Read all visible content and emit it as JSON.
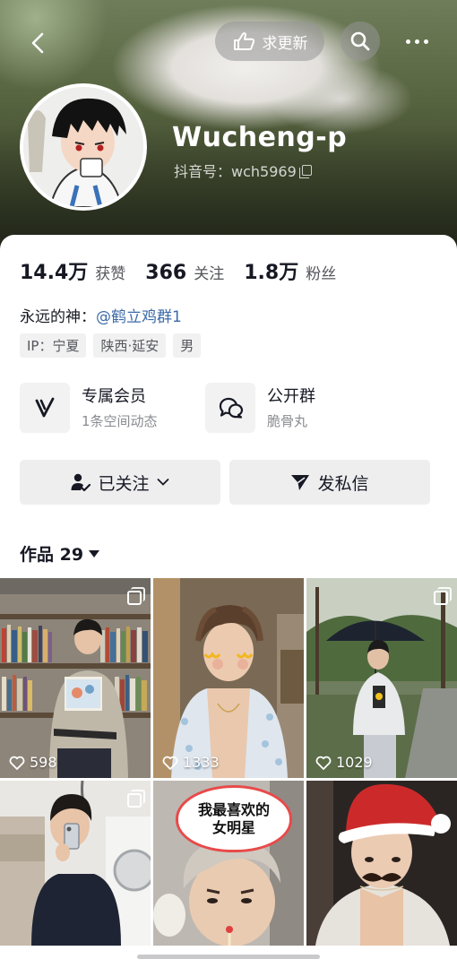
{
  "header": {
    "request_update_label": "求更新"
  },
  "profile": {
    "nickname": "Wucheng-p",
    "douyin_id": "抖音号：wch5969"
  },
  "stats": [
    {
      "value": "14.4万",
      "label": "获赞"
    },
    {
      "value": "366",
      "label": "关注"
    },
    {
      "value": "1.8万",
      "label": "粉丝"
    }
  ],
  "bio": {
    "prefix": "永远的神：",
    "mention": "@鹤立鸡群1"
  },
  "tags": [
    "IP：宁夏",
    "陕西·延安",
    "男"
  ],
  "features": [
    {
      "title": "专属会员",
      "subtitle": "1条空间动态"
    },
    {
      "title": "公开群",
      "subtitle": "脆骨丸"
    }
  ],
  "actions": {
    "followed_label": "已关注",
    "message_label": "发私信"
  },
  "works": {
    "label": "作品 29"
  },
  "videos": [
    {
      "likes": "598",
      "multi": true
    },
    {
      "likes": "1333",
      "multi": false
    },
    {
      "likes": "1029",
      "multi": true
    },
    {
      "likes": "",
      "multi": true
    },
    {
      "likes": "",
      "multi": false,
      "caption_line1": "我最喜欢的",
      "caption_line2": "女明星"
    },
    {
      "likes": "",
      "multi": false
    }
  ]
}
